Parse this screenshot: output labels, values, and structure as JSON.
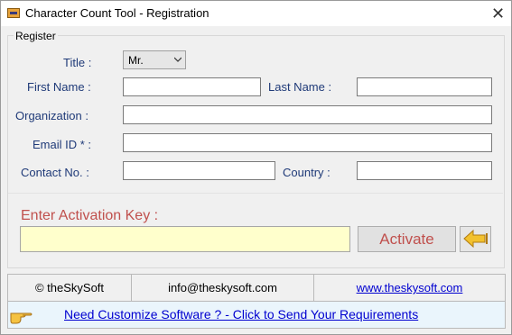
{
  "window": {
    "title": "Character Count Tool - Registration",
    "close_glyph": "✕"
  },
  "group": {
    "legend": "Register"
  },
  "form": {
    "title_label": "Title :",
    "title_value": "Mr.",
    "first_name_label": "First Name :",
    "first_name_value": "",
    "last_name_label": "Last Name :",
    "last_name_value": "",
    "organization_label": "Organization :",
    "organization_value": "",
    "email_label": "Email ID * :",
    "email_value": "",
    "contact_label": "Contact No. :",
    "contact_value": "",
    "country_label": "Country :",
    "country_value": ""
  },
  "activation": {
    "label": "Enter Activation Key  :",
    "value": "",
    "button_label": "Activate",
    "arrow_icon": "arrow-left-icon"
  },
  "footer": {
    "copyright": "© theSkySoft",
    "email": "info@theskysoft.com",
    "website": "www.theskysoft.com"
  },
  "banner": {
    "text": "Need Customize Software ? - Click to Send Your Requirements",
    "icon": "pointing-hand-icon"
  },
  "colors": {
    "label": "#1f3a78",
    "accent": "#c0504d",
    "key_bg": "#ffffcc",
    "link": "#0000d0"
  }
}
